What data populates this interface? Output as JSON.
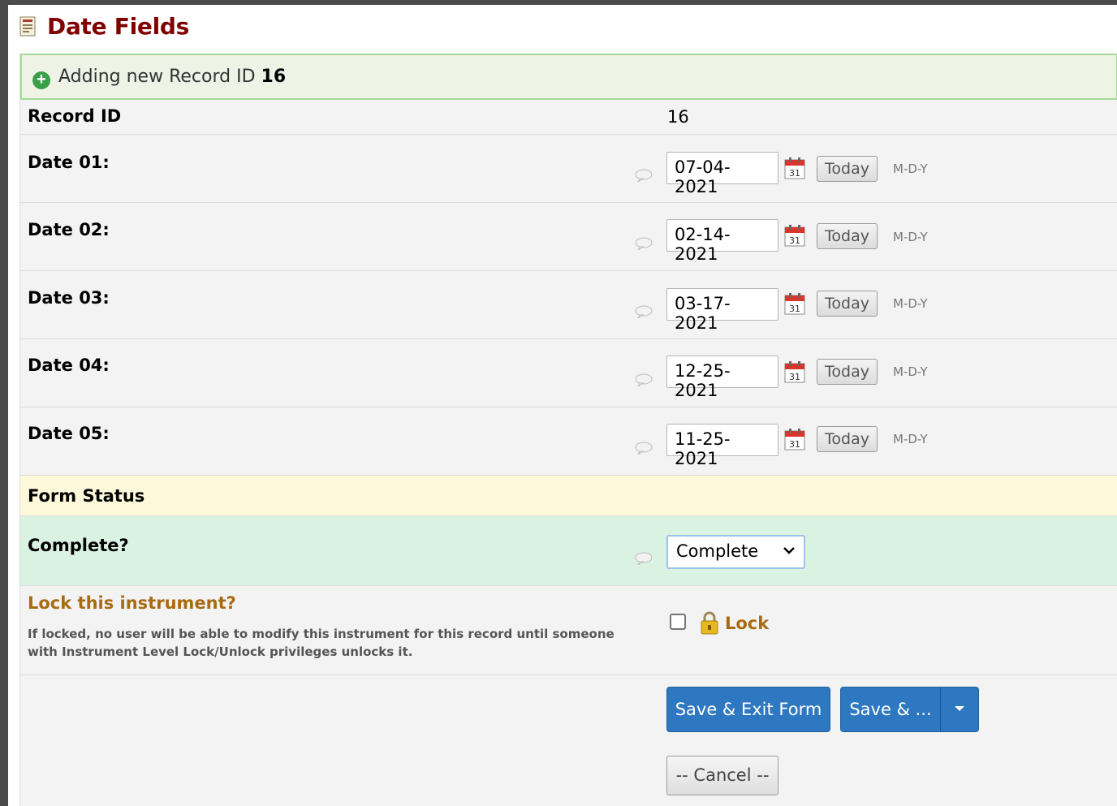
{
  "header": {
    "title": "Date Fields",
    "icon": "form-icon"
  },
  "notice": {
    "prefix": "Adding new Record ID",
    "record_id": "16"
  },
  "record": {
    "label": "Record ID",
    "value": "16"
  },
  "dates": [
    {
      "label": "Date 01:",
      "value": "07-04-2021",
      "today_label": "Today",
      "format": "M-D-Y"
    },
    {
      "label": "Date 02:",
      "value": "02-14-2021",
      "today_label": "Today",
      "format": "M-D-Y"
    },
    {
      "label": "Date 03:",
      "value": "03-17-2021",
      "today_label": "Today",
      "format": "M-D-Y"
    },
    {
      "label": "Date 04:",
      "value": "12-25-2021",
      "today_label": "Today",
      "format": "M-D-Y"
    },
    {
      "label": "Date 05:",
      "value": "11-25-2021",
      "today_label": "Today",
      "format": "M-D-Y"
    }
  ],
  "form_status": {
    "section_label": "Form Status",
    "complete_label": "Complete?",
    "complete_value": "Complete"
  },
  "lock": {
    "title": "Lock this instrument?",
    "note": "If locked, no user will be able to modify this instrument for this record until someone with Instrument Level Lock/Unlock privileges unlocks it.",
    "label": "Lock",
    "checked": false
  },
  "buttons": {
    "save_exit": "Save & Exit Form",
    "save_more": "Save & ...",
    "cancel": "-- Cancel --"
  },
  "colors": {
    "title": "#800000",
    "primary": "#2e78c1",
    "lock": "#a86b14",
    "complete_row": "#daf2e1",
    "status_row": "#fcf8d9"
  }
}
